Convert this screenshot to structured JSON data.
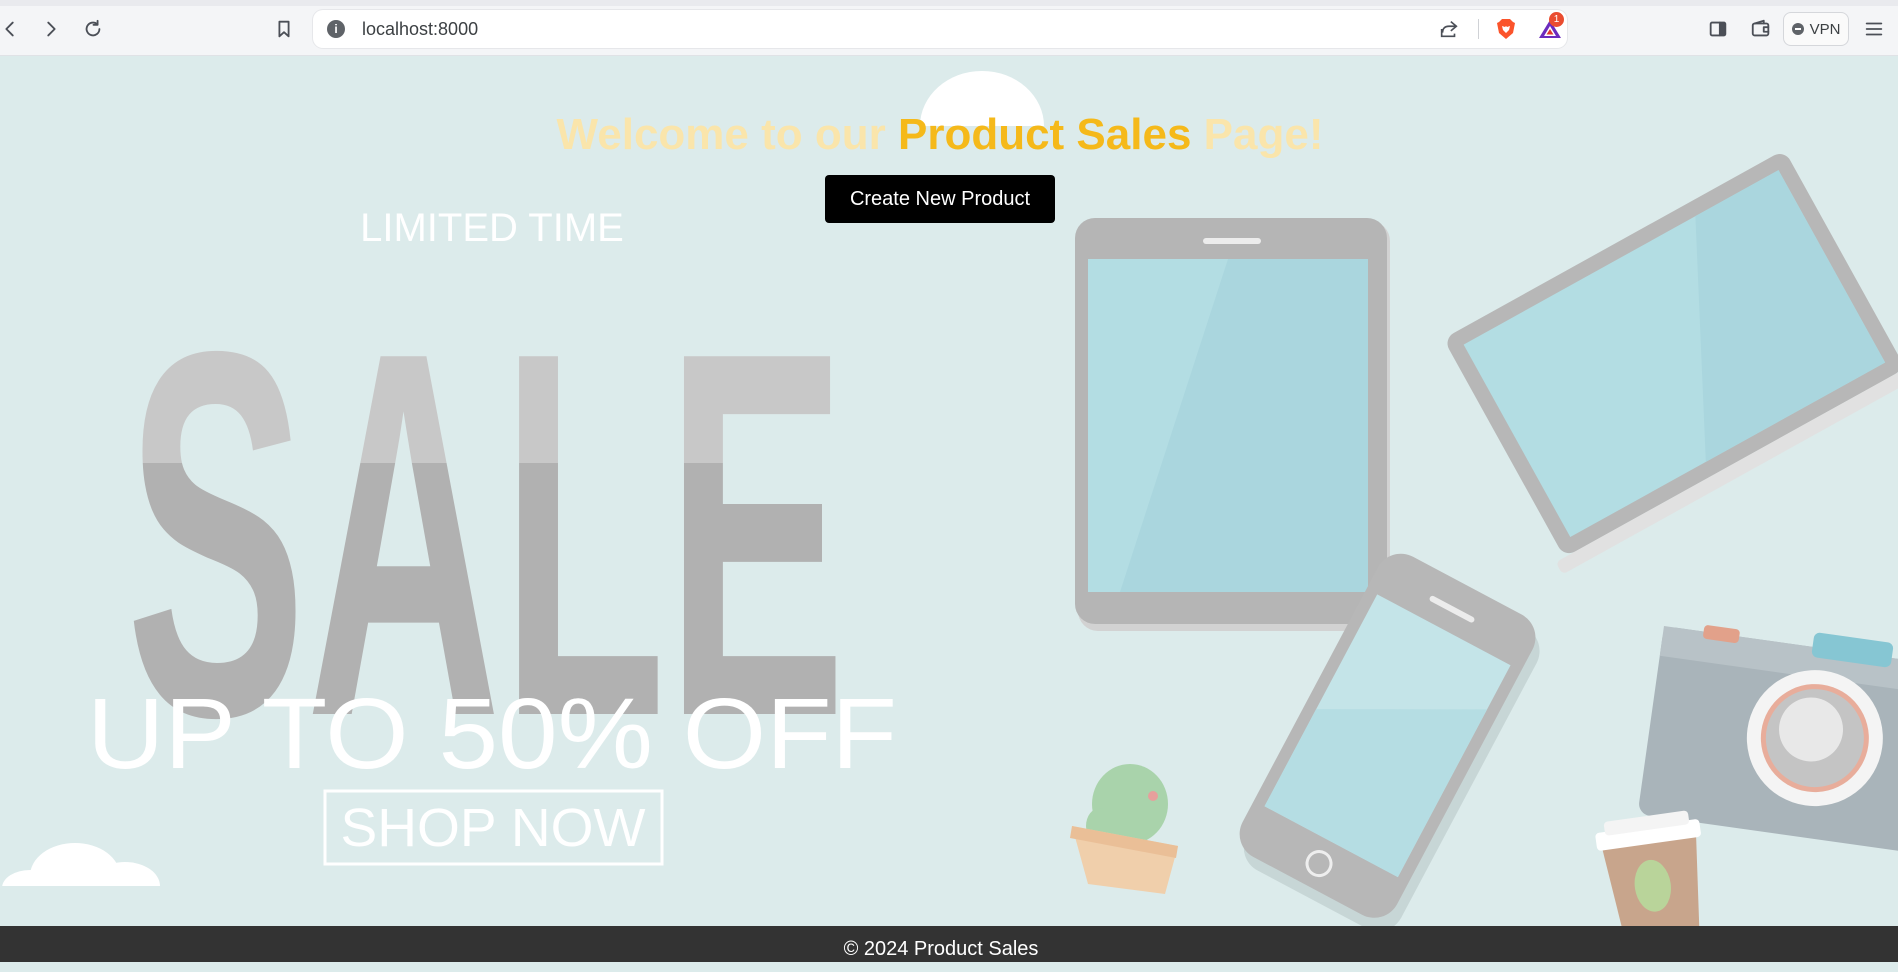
{
  "browser": {
    "url": "localhost:8000",
    "vpn_label": "VPN",
    "rewards_badge": "1"
  },
  "hero": {
    "title_prefix": "Welcome to our ",
    "title_highlight": "Product Sales",
    "title_suffix": " Page!",
    "create_button_label": "Create New Product"
  },
  "banner": {
    "limited_time": "LIMITED TIME",
    "sale": "SALE",
    "discount": "UP TO 50% OFF",
    "shop_now": "SHOP NOW"
  },
  "footer": {
    "text": "© 2024 Product Sales"
  },
  "colors": {
    "page_background": "#dcebeb",
    "title_highlight": "#f5b91a",
    "button_background": "#000000",
    "footer_background": "#333333"
  },
  "icons": [
    "back-icon",
    "forward-icon",
    "reload-icon",
    "bookmark-icon",
    "info-icon",
    "share-icon",
    "brave-lion-icon",
    "brave-rewards-icon",
    "sidebar-icon",
    "wallet-icon",
    "vpn-icon",
    "menu-icon"
  ]
}
